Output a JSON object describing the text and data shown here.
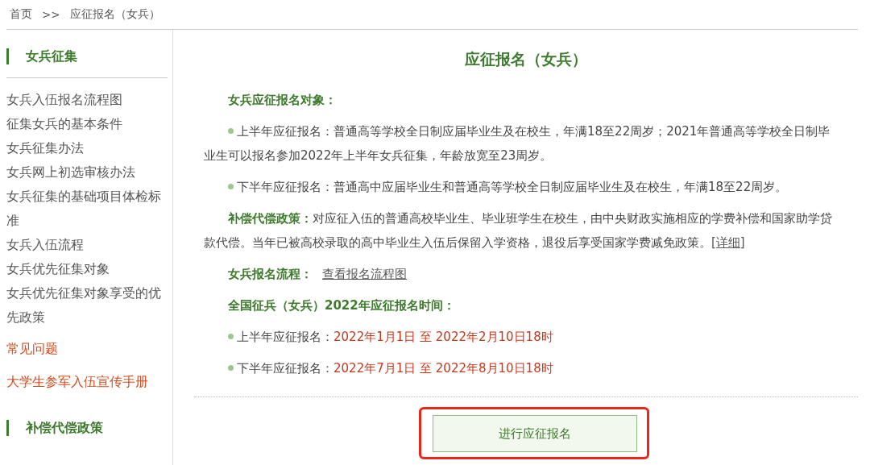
{
  "breadcrumb": {
    "home": "首页",
    "separator": ">>",
    "current": "应征报名（女兵）"
  },
  "sidebar": {
    "sections": [
      {
        "title": "女兵征集",
        "items": [
          {
            "label": "女兵入伍报名流程图",
            "kind": "link"
          },
          {
            "label": "征集女兵的基本条件",
            "kind": "link"
          },
          {
            "label": "女兵征集办法",
            "kind": "link"
          },
          {
            "label": "女兵网上初选审核办法",
            "kind": "link"
          },
          {
            "label": "女兵征集的基础项目体检标准",
            "kind": "link"
          },
          {
            "label": "女兵入伍流程",
            "kind": "link"
          },
          {
            "label": "女兵优先征集对象",
            "kind": "link"
          },
          {
            "label": "女兵优先征集对象享受的优先政策",
            "kind": "link"
          },
          {
            "label": "常见问题",
            "kind": "featured"
          },
          {
            "label": "大学生参军入伍宣传手册",
            "kind": "featured"
          }
        ]
      },
      {
        "title": "补偿代偿政策"
      }
    ]
  },
  "content": {
    "title": "应征报名（女兵）",
    "blocks": [
      {
        "kind": "heading",
        "text": "女兵应征报名对象："
      },
      {
        "kind": "bullet",
        "label": "上半年应征报名：",
        "text": "普通高等学校全日制应届毕业生及在校生，年满18至22周岁；2021年普通高等学校全日制毕业生可以报名参加2022年上半年女兵征集，年龄放宽至23周岁。"
      },
      {
        "kind": "bullet",
        "label": "下半年应征报名：",
        "text": "普通高中应届毕业生和普通高等学校全日制应届毕业生及在校生，年满18至22周岁。"
      },
      {
        "kind": "policy",
        "label": "补偿代偿政策：",
        "text": "对应征入伍的普通高校毕业生、毕业班学生在校生，由中央财政实施相应的学费补偿和国家助学贷款代偿。当年已被高校录取的高中毕业生入伍后保留入学资格，退役后享受国家学费减免政策。",
        "link": "详细",
        "link_open": "[",
        "link_close": "]"
      },
      {
        "kind": "policy",
        "label": "女兵报名流程：",
        "link": "查看报名流程图"
      },
      {
        "kind": "heading",
        "text": "全国征兵（女兵）2022年应征报名时间："
      },
      {
        "kind": "date",
        "label": "上半年应征报名：",
        "text": "2022年1月1日 至 2022年2月10日18时"
      },
      {
        "kind": "date",
        "label": "下半年应征报名：",
        "text": "2022年7月1日 至 2022年8月10日18时"
      }
    ],
    "button": {
      "label": "进行应征报名",
      "highlighted": true
    }
  }
}
